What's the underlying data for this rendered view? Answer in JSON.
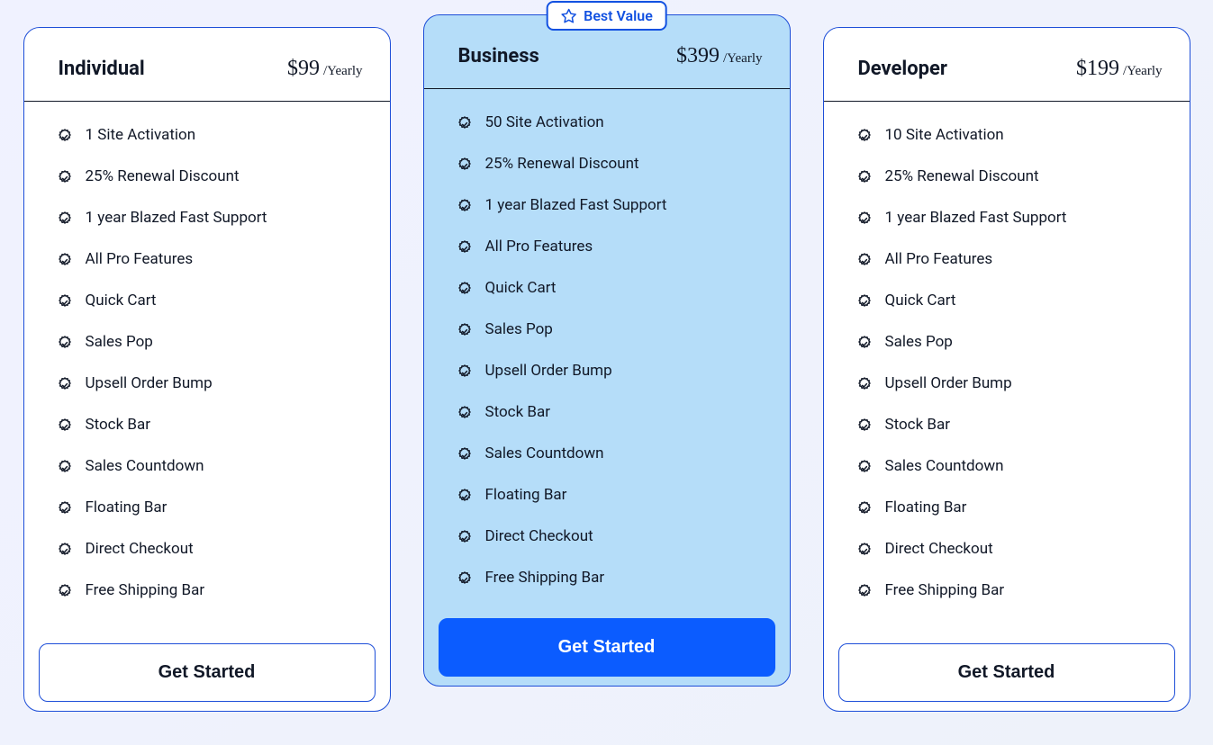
{
  "badge": {
    "label": "Best Value"
  },
  "plans": [
    {
      "name": "Individual",
      "price": "$99",
      "period": "/Yearly",
      "cta": "Get Started",
      "featured": false,
      "features": [
        "1 Site Activation",
        "25% Renewal Discount",
        "1 year Blazed Fast Support",
        "All Pro Features",
        "Quick Cart",
        "Sales Pop",
        "Upsell Order Bump",
        "Stock Bar",
        "Sales Countdown",
        "Floating Bar",
        "Direct Checkout",
        "Free Shipping Bar"
      ]
    },
    {
      "name": "Business",
      "price": "$399",
      "period": "/Yearly",
      "cta": "Get Started",
      "featured": true,
      "features": [
        "50 Site Activation",
        "25% Renewal Discount",
        "1 year Blazed Fast Support",
        "All Pro Features",
        "Quick Cart",
        "Sales Pop",
        "Upsell Order Bump",
        "Stock Bar",
        "Sales Countdown",
        "Floating Bar",
        "Direct Checkout",
        "Free Shipping Bar"
      ]
    },
    {
      "name": "Developer",
      "price": "$199",
      "period": "/Yearly",
      "cta": "Get Started",
      "featured": false,
      "features": [
        "10 Site Activation",
        "25% Renewal Discount",
        "1 year Blazed Fast Support",
        "All Pro Features",
        "Quick Cart",
        "Sales Pop",
        "Upsell Order Bump",
        "Stock Bar",
        "Sales Countdown",
        "Floating Bar",
        "Direct Checkout",
        "Free Shipping Bar"
      ]
    }
  ]
}
